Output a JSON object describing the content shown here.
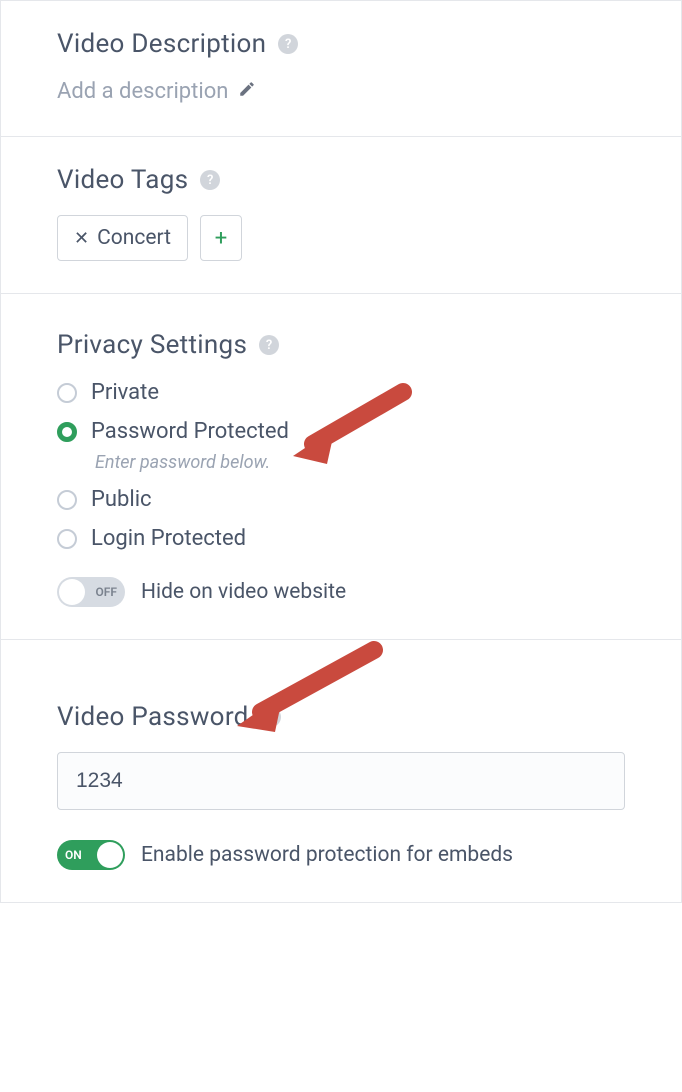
{
  "description": {
    "title": "Video Description",
    "placeholder": "Add a description"
  },
  "tags": {
    "title": "Video Tags",
    "items": [
      "Concert"
    ]
  },
  "privacy": {
    "title": "Privacy Settings",
    "options": {
      "private": "Private",
      "password_protected": "Password Protected",
      "password_hint": "Enter password below.",
      "public": "Public",
      "login_protected": "Login Protected"
    },
    "hide_toggle": {
      "state": "OFF",
      "label": "Hide on video website"
    }
  },
  "password": {
    "title": "Video Password",
    "value": "1234",
    "embed_toggle": {
      "state": "ON",
      "label": "Enable password protection for embeds"
    }
  }
}
